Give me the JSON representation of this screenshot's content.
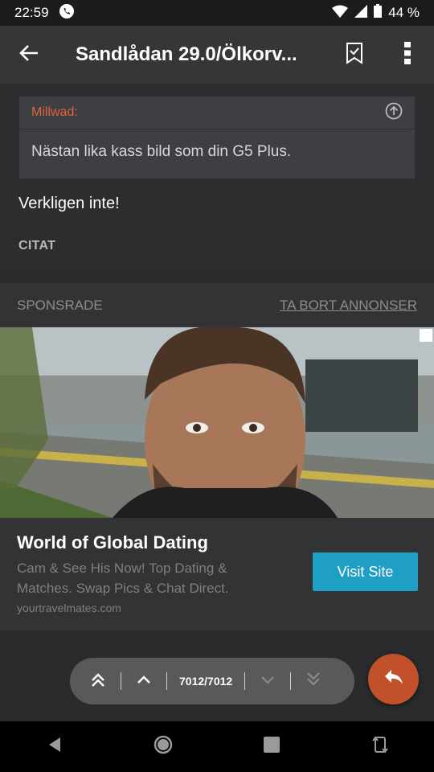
{
  "status_bar": {
    "time": "22:59",
    "battery": "44 %",
    "icons": [
      "whatsapp-icon",
      "wifi-icon",
      "signal-icon",
      "battery-icon"
    ]
  },
  "app_bar": {
    "title": "Sandlådan 29.0/Ölkorv...",
    "icons": [
      "back-arrow-icon",
      "bookmark-icon",
      "more-vert-icon"
    ]
  },
  "post": {
    "quote_author": "Millwad:",
    "quote_text": "Nästan lika kass bild som din G5 Plus.",
    "text": "Verkligen inte!",
    "citat_label": "CITAT"
  },
  "ad": {
    "sponsored_label": "SPONSRADE",
    "remove_ads_label": "TA BORT ANNONSER",
    "title": "World of Global Dating",
    "description": "Cam & See His Now! Top Dating & Matches. Swap Pics & Chat Direct.",
    "domain": "yourtravelmates.com",
    "button_label": "Visit Site"
  },
  "pager": {
    "count": "7012/7012"
  },
  "colors": {
    "accent_orange": "#c1502b",
    "quote_author": "#e0643a",
    "visit_button": "#1f9fc5"
  }
}
